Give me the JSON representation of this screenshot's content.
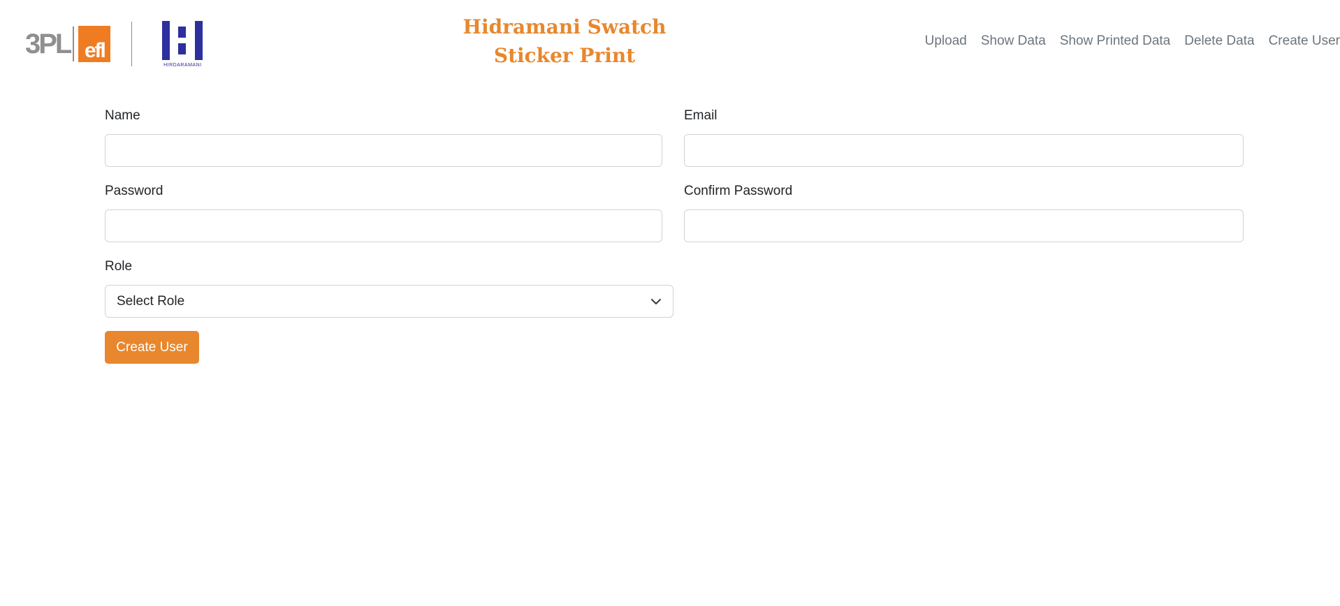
{
  "header": {
    "logo_3pl_text": "3PL",
    "logo_efl_text": "efl",
    "logo_hirdaramani_text": "HIRDARAMANI",
    "brand_title_line1": "Hidramani Swatch",
    "brand_title_line2": "Sticker Print",
    "brand_color": "#e8872d"
  },
  "nav": {
    "items": [
      {
        "label": "Upload"
      },
      {
        "label": "Show Data"
      },
      {
        "label": "Show Printed Data"
      },
      {
        "label": "Delete Data"
      },
      {
        "label": "Create User"
      }
    ]
  },
  "form": {
    "name": {
      "label": "Name",
      "value": ""
    },
    "email": {
      "label": "Email",
      "value": ""
    },
    "password": {
      "label": "Password",
      "value": ""
    },
    "confirm_password": {
      "label": "Confirm Password",
      "value": ""
    },
    "role": {
      "label": "Role",
      "selected": "Select Role",
      "icon": "chevron-down-icon"
    },
    "submit_label": "Create User",
    "submit_color": "#e8872d"
  }
}
